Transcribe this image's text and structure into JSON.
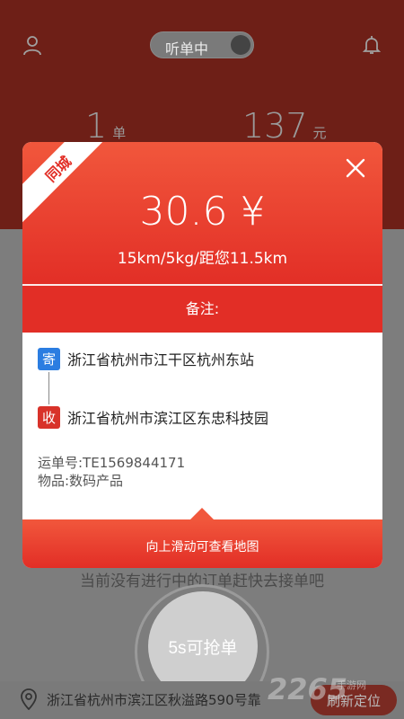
{
  "header": {
    "toggle_label": "听单中",
    "orders_count": "1",
    "orders_unit": "单",
    "income_amount": "137",
    "income_unit": "元"
  },
  "modal": {
    "ribbon": "同城",
    "price": "30.6 ¥",
    "subinfo": "15km/5kg/距您11.5km",
    "remark_label": "备注:",
    "from_tag": "寄",
    "from_address": "浙江省杭州市江干区杭州东站",
    "to_tag": "收",
    "to_address": "浙江省杭州市滨江区东忠科技园",
    "waybill": "运单号:TE1569844171",
    "goods": "物品:数码产品",
    "footer_hint": "向上滑动可查看地图"
  },
  "main": {
    "empty_message": "当前没有进行中的订单赶快去接单吧",
    "grab_button": "5s可抢单"
  },
  "bottom_bar": {
    "location_text": "浙江省杭州市滨江区秋溢路590号靠",
    "refresh_button": "刷新定位"
  },
  "watermark": {
    "main": "2265",
    "sub": "手游网"
  },
  "colors": {
    "accent_red": "#e22e26",
    "accent_orange": "#f1573c",
    "sender_blue": "#2b7de1",
    "header_dark_red": "#6e1f17"
  },
  "icons": [
    "user-icon",
    "bell-icon",
    "close-icon",
    "location-pin-icon"
  ]
}
